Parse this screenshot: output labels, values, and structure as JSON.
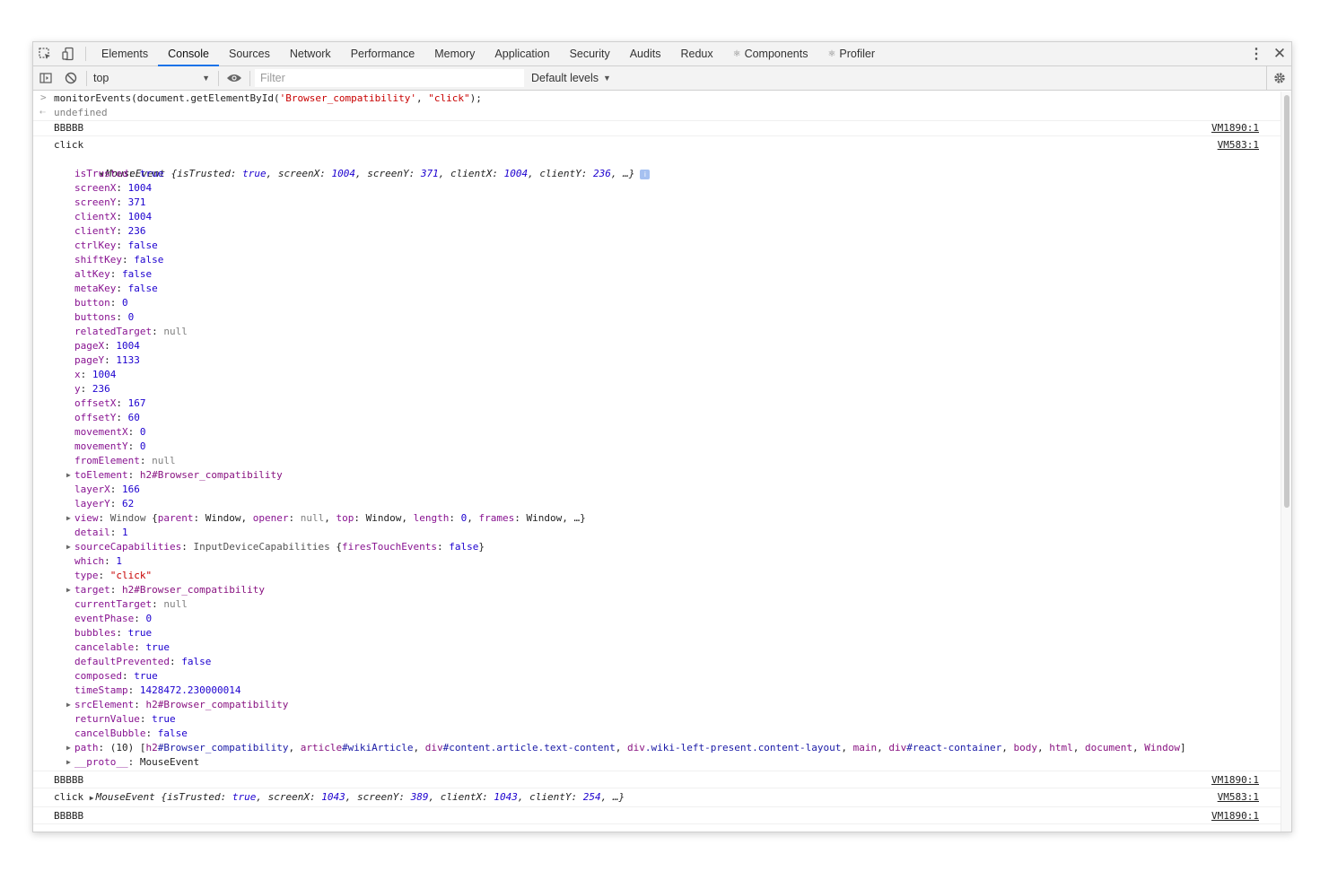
{
  "tabs": [
    "Elements",
    "Console",
    "Sources",
    "Network",
    "Performance",
    "Memory",
    "Application",
    "Security",
    "Audits",
    "Redux",
    "Components",
    "Profiler"
  ],
  "active_tab": "Console",
  "toolbar": {
    "context": "top",
    "filter_placeholder": "Filter",
    "levels": "Default levels"
  },
  "console": {
    "command": "monitorEvents(document.getElementById(",
    "command_arg1": "'Browser_compatibility'",
    "command_sep": ", ",
    "command_arg2": "\"click\"",
    "command_end": ");",
    "result": "undefined",
    "log1": {
      "text": "BBBBB",
      "source": "VM1890:1"
    },
    "click_label": "click",
    "click_source": "VM583:1",
    "mouse_event_summary": {
      "prefix": "MouseEvent {",
      "isTrusted_k": "isTrusted",
      "isTrusted_v": "true",
      "screenX_k": "screenX",
      "screenX_v": "1004",
      "screenY_k": "screenY",
      "screenY_v": "371",
      "clientX_k": "clientX",
      "clientX_v": "1004",
      "clientY_k": "clientY",
      "clientY_v": "236",
      "suffix": ", …}"
    },
    "properties": [
      {
        "k": "isTrusted",
        "v": "true",
        "t": "bool"
      },
      {
        "k": "screenX",
        "v": "1004",
        "t": "num"
      },
      {
        "k": "screenY",
        "v": "371",
        "t": "num"
      },
      {
        "k": "clientX",
        "v": "1004",
        "t": "num"
      },
      {
        "k": "clientY",
        "v": "236",
        "t": "num"
      },
      {
        "k": "ctrlKey",
        "v": "false",
        "t": "bool"
      },
      {
        "k": "shiftKey",
        "v": "false",
        "t": "bool"
      },
      {
        "k": "altKey",
        "v": "false",
        "t": "bool"
      },
      {
        "k": "metaKey",
        "v": "false",
        "t": "bool"
      },
      {
        "k": "button",
        "v": "0",
        "t": "num"
      },
      {
        "k": "buttons",
        "v": "0",
        "t": "num"
      },
      {
        "k": "relatedTarget",
        "v": "null",
        "t": "null"
      },
      {
        "k": "pageX",
        "v": "1004",
        "t": "num"
      },
      {
        "k": "pageY",
        "v": "1133",
        "t": "num"
      },
      {
        "k": "x",
        "v": "1004",
        "t": "num"
      },
      {
        "k": "y",
        "v": "236",
        "t": "num"
      },
      {
        "k": "offsetX",
        "v": "167",
        "t": "num"
      },
      {
        "k": "offsetY",
        "v": "60",
        "t": "num"
      },
      {
        "k": "movementX",
        "v": "0",
        "t": "num"
      },
      {
        "k": "movementY",
        "v": "0",
        "t": "num"
      },
      {
        "k": "fromElement",
        "v": "null",
        "t": "null"
      },
      {
        "k": "toElement",
        "v": "h2#Browser_compatibility",
        "t": "node",
        "expandable": true
      },
      {
        "k": "layerX",
        "v": "166",
        "t": "num"
      },
      {
        "k": "layerY",
        "v": "62",
        "t": "num"
      },
      {
        "k": "view",
        "v": "",
        "t": "view",
        "expandable": true
      },
      {
        "k": "detail",
        "v": "1",
        "t": "num"
      },
      {
        "k": "sourceCapabilities",
        "v": "",
        "t": "caps",
        "expandable": true
      },
      {
        "k": "which",
        "v": "1",
        "t": "num"
      },
      {
        "k": "type",
        "v": "\"click\"",
        "t": "str"
      },
      {
        "k": "target",
        "v": "h2#Browser_compatibility",
        "t": "node",
        "expandable": true
      },
      {
        "k": "currentTarget",
        "v": "null",
        "t": "null"
      },
      {
        "k": "eventPhase",
        "v": "0",
        "t": "num"
      },
      {
        "k": "bubbles",
        "v": "true",
        "t": "bool"
      },
      {
        "k": "cancelable",
        "v": "true",
        "t": "bool"
      },
      {
        "k": "defaultPrevented",
        "v": "false",
        "t": "bool"
      },
      {
        "k": "composed",
        "v": "true",
        "t": "bool"
      },
      {
        "k": "timeStamp",
        "v": "1428472.230000014",
        "t": "num"
      },
      {
        "k": "srcElement",
        "v": "h2#Browser_compatibility",
        "t": "node",
        "expandable": true
      },
      {
        "k": "returnValue",
        "v": "true",
        "t": "bool"
      },
      {
        "k": "cancelBubble",
        "v": "false",
        "t": "bool"
      },
      {
        "k": "path",
        "v": "",
        "t": "path",
        "expandable": true
      },
      {
        "k": "__proto__",
        "v": "MouseEvent",
        "t": "proto",
        "expandable": true
      }
    ],
    "view_value": {
      "type": "Window",
      "open": " {",
      "parent_k": "parent",
      "parent_v": "Window",
      "opener_k": "opener",
      "opener_v": "null",
      "top_k": "top",
      "top_v": "Window",
      "length_k": "length",
      "length_v": "0",
      "frames_k": "frames",
      "frames_v": "Window",
      "close": ", …}"
    },
    "caps_value": {
      "type": "InputDeviceCapabilities",
      "open": " {",
      "k": "firesTouchEvents",
      "v": "false",
      "close": "}"
    },
    "path_value": {
      "count": "(10) [",
      "items": [
        {
          "tag": "h2",
          "rest": "#Browser_compatibility"
        },
        {
          "tag": "article",
          "rest": "#wikiArticle"
        },
        {
          "tag": "div",
          "rest": "#content.article.text-content"
        },
        {
          "tag": "div",
          "rest": ".wiki-left-present.content-layout"
        },
        {
          "tag": "main",
          "rest": ""
        },
        {
          "tag": "div",
          "rest": "#react-container"
        },
        {
          "tag": "body",
          "rest": ""
        },
        {
          "tag": "html",
          "rest": ""
        },
        {
          "tag": "document",
          "rest": ""
        },
        {
          "tag": "Window",
          "rest": ""
        }
      ],
      "close": "]"
    },
    "log2": {
      "text": "BBBBB",
      "source": "VM1890:1"
    },
    "click2": {
      "label": "click",
      "source": "VM583:1",
      "prefix": "MouseEvent {",
      "isTrusted_k": "isTrusted",
      "isTrusted_v": "true",
      "screenX_k": "screenX",
      "screenX_v": "1043",
      "screenY_k": "screenY",
      "screenY_v": "389",
      "clientX_k": "clientX",
      "clientX_v": "1043",
      "clientY_k": "clientY",
      "clientY_v": "254",
      "suffix": ", …}"
    },
    "log3": {
      "text": "BBBBB",
      "source": "VM1890:1"
    }
  }
}
